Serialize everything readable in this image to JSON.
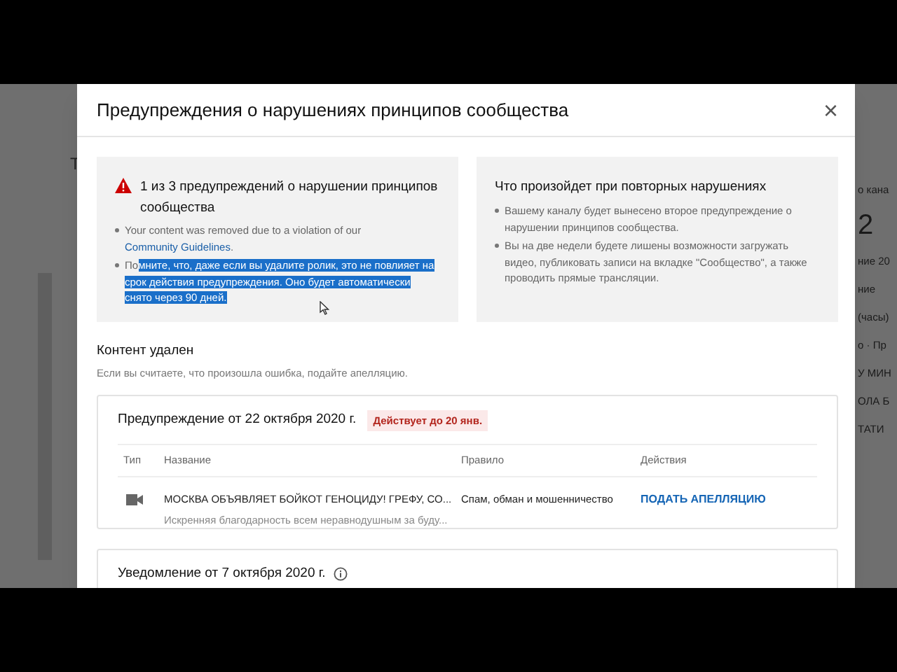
{
  "background": {
    "left_fragment": "Т",
    "right_fragments": [
      "о кана",
      "2",
      "ние 20",
      "ние",
      "(часы)",
      "о · Пр",
      "У МИН",
      "ОЛА Б",
      "ТАТИ"
    ]
  },
  "dialog": {
    "title": "Предупреждения о нарушениях принципов сообщества",
    "close": "×",
    "strike_card": {
      "heading": "1 из 3 предупреждений о нарушении принципов сообщества",
      "bullets": [
        {
          "kind": "link",
          "text": "Your content was removed due to a violation of our ",
          "link": "Community Guidelines",
          "after": "."
        },
        {
          "kind": "selection",
          "text": "По",
          "selected_text": "мните, что, даже если вы удалите ролик, это не повлияет на срок действия предупреждения. Оно будет автоматически снято через 90 дней."
        }
      ]
    },
    "repeat_card": {
      "heading": "Что произойдет при повторных нарушениях",
      "bullets": [
        "Вашему каналу будет вынесено второе предупреждение о нарушении принципов сообщества.",
        "Вы на две недели будете лишены возможности загружать видео, публиковать записи на вкладке \"Сообщество\", а также проводить прямые трансляции."
      ]
    },
    "section_title": "Контент удален",
    "section_hint": "Если вы считаете, что произошла ошибка, подайте апелляцию.",
    "warning": {
      "title": "Предупреждение от 22 октября 2020 г.",
      "badge": "Действует до 20 янв.",
      "columns": [
        "Тип",
        "Название",
        "Правило",
        "Действия"
      ],
      "row": {
        "title": "МОСКВА ОБЪЯВЛЯЕТ БОЙКОТ ГЕНОЦИДУ! ГРЕФУ, СО...",
        "description": "Искренняя благодарность всем неравнодушным за буду...",
        "rule": "Спам, обман и мошенничество",
        "action": "ПОДАТЬ АПЕЛЛЯЦИЮ"
      }
    },
    "notice": {
      "title": "Уведомление от 7 октября 2020 г."
    }
  }
}
